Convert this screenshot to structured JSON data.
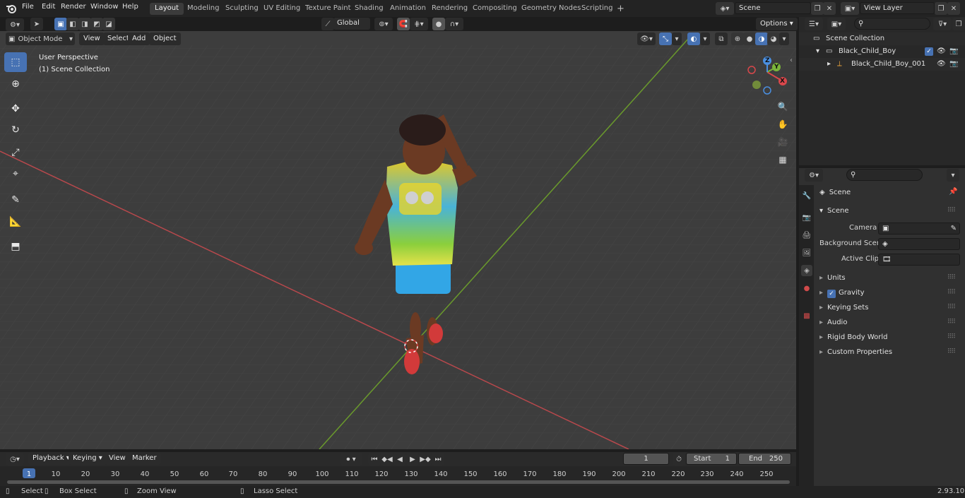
{
  "topbar": {
    "menus": [
      "File",
      "Edit",
      "Render",
      "Window",
      "Help"
    ],
    "workspaces": [
      "Layout",
      "Modeling",
      "Sculpting",
      "UV Editing",
      "Texture Paint",
      "Shading",
      "Animation",
      "Rendering",
      "Compositing",
      "Geometry Nodes",
      "Scripting"
    ],
    "active_workspace": "Layout",
    "add_tab_label": "+",
    "scene_name": "Scene",
    "view_layer_name": "View Layer"
  },
  "viewport_header": {
    "mode": "Object Mode",
    "menus": [
      "View",
      "Select",
      "Add",
      "Object"
    ],
    "transform_orientation": "Global",
    "options_label": "Options"
  },
  "viewport": {
    "perspective_label": "User Perspective",
    "collection_label": "(1) Scene Collection",
    "gizmo_axes": {
      "x": "X",
      "y": "Y",
      "z": "Z"
    }
  },
  "outliner": {
    "root": "Scene Collection",
    "items": [
      {
        "label": "Black_Child_Boy",
        "level": 1
      },
      {
        "label": "Black_Child_Boy_001",
        "level": 2
      }
    ]
  },
  "properties": {
    "breadcrumb": "Scene",
    "panel_title": "Scene",
    "fields": [
      {
        "label": "Camera",
        "value": ""
      },
      {
        "label": "Background Scene",
        "value": ""
      },
      {
        "label": "Active Clip",
        "value": ""
      }
    ],
    "subpanels": [
      "Units",
      "Gravity",
      "Keying Sets",
      "Audio",
      "Rigid Body World",
      "Custom Properties"
    ],
    "gravity_checked": true
  },
  "timeline": {
    "menus": [
      "Playback",
      "Keying",
      "View",
      "Marker"
    ],
    "current_frame": "1",
    "start_label": "Start",
    "start_value": "1",
    "end_label": "End",
    "end_value": "250",
    "ticks": [
      "1",
      "10",
      "20",
      "30",
      "40",
      "50",
      "60",
      "70",
      "80",
      "90",
      "100",
      "110",
      "120",
      "130",
      "140",
      "150",
      "160",
      "170",
      "180",
      "190",
      "200",
      "210",
      "220",
      "230",
      "240",
      "250"
    ]
  },
  "statusbar": {
    "select": "Select",
    "box_select": "Box Select",
    "zoom_view": "Zoom View",
    "lasso_select": "Lasso Select",
    "version": "2.93.10"
  },
  "colors": {
    "accent": "#4772b3",
    "x_axis": "#d9474b",
    "y_axis": "#7bb53a",
    "z_axis": "#4a8fe0"
  }
}
